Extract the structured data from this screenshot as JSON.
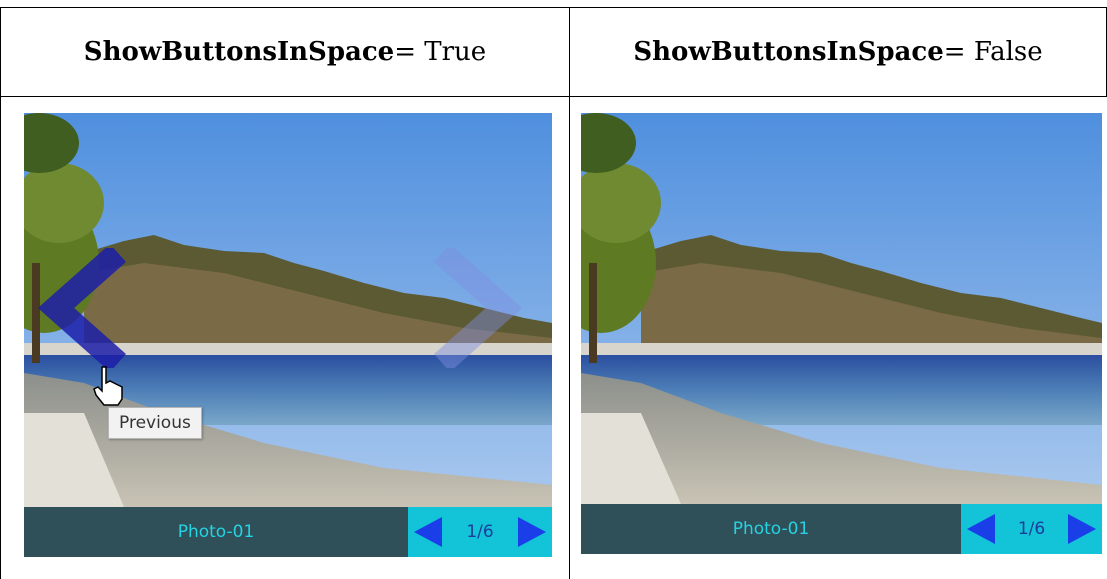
{
  "columns": [
    {
      "header_bold": "ShowButtonsInSpace",
      "header_rest": " = True",
      "viewer": {
        "caption": "Photo-01",
        "counter": "1/6",
        "tooltip": "Previous"
      }
    },
    {
      "header_bold": "ShowButtonsInSpace",
      "header_rest": " = False",
      "viewer": {
        "caption": "Photo-01",
        "counter": "1/6"
      }
    }
  ],
  "icons": [
    "chevron-left-icon",
    "chevron-right-icon",
    "hand-cursor-icon",
    "triangle-left-icon",
    "triangle-right-icon"
  ],
  "colors": {
    "caption_bar": "#2f4f59",
    "nav_bar": "#13c3d8",
    "nav_arrow": "#1a3ee8",
    "caption_text": "#26d3e2"
  }
}
